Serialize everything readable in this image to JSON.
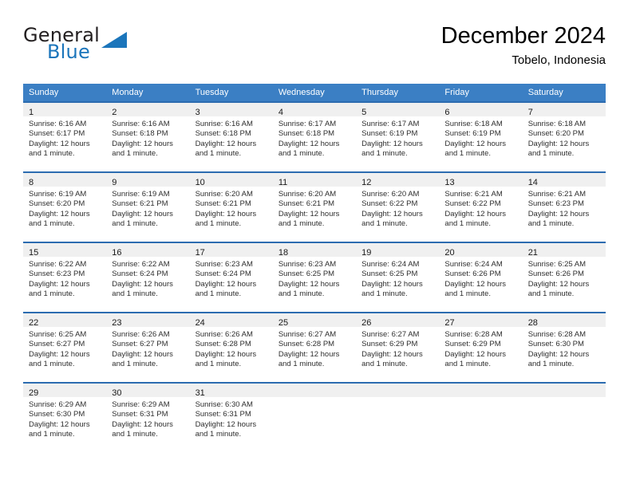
{
  "logo": {
    "word1": "General",
    "word2": "Blue",
    "triangle_color": "#1b75bb",
    "triangle_icon": "triangle-icon"
  },
  "header": {
    "title": "December 2024",
    "location": "Tobelo, Indonesia"
  },
  "colors": {
    "header_row_bg": "#3b7fc4",
    "cell_top_border": "#2c6cb0",
    "daynum_band_bg": "#f0f0f0",
    "brand_blue": "#1b75bb"
  },
  "weekday_headers": [
    "Sunday",
    "Monday",
    "Tuesday",
    "Wednesday",
    "Thursday",
    "Friday",
    "Saturday"
  ],
  "weeks": [
    [
      {
        "day": "1",
        "sunrise": "Sunrise: 6:16 AM",
        "sunset": "Sunset: 6:17 PM",
        "daylight1": "Daylight: 12 hours",
        "daylight2": "and 1 minute."
      },
      {
        "day": "2",
        "sunrise": "Sunrise: 6:16 AM",
        "sunset": "Sunset: 6:18 PM",
        "daylight1": "Daylight: 12 hours",
        "daylight2": "and 1 minute."
      },
      {
        "day": "3",
        "sunrise": "Sunrise: 6:16 AM",
        "sunset": "Sunset: 6:18 PM",
        "daylight1": "Daylight: 12 hours",
        "daylight2": "and 1 minute."
      },
      {
        "day": "4",
        "sunrise": "Sunrise: 6:17 AM",
        "sunset": "Sunset: 6:18 PM",
        "daylight1": "Daylight: 12 hours",
        "daylight2": "and 1 minute."
      },
      {
        "day": "5",
        "sunrise": "Sunrise: 6:17 AM",
        "sunset": "Sunset: 6:19 PM",
        "daylight1": "Daylight: 12 hours",
        "daylight2": "and 1 minute."
      },
      {
        "day": "6",
        "sunrise": "Sunrise: 6:18 AM",
        "sunset": "Sunset: 6:19 PM",
        "daylight1": "Daylight: 12 hours",
        "daylight2": "and 1 minute."
      },
      {
        "day": "7",
        "sunrise": "Sunrise: 6:18 AM",
        "sunset": "Sunset: 6:20 PM",
        "daylight1": "Daylight: 12 hours",
        "daylight2": "and 1 minute."
      }
    ],
    [
      {
        "day": "8",
        "sunrise": "Sunrise: 6:19 AM",
        "sunset": "Sunset: 6:20 PM",
        "daylight1": "Daylight: 12 hours",
        "daylight2": "and 1 minute."
      },
      {
        "day": "9",
        "sunrise": "Sunrise: 6:19 AM",
        "sunset": "Sunset: 6:21 PM",
        "daylight1": "Daylight: 12 hours",
        "daylight2": "and 1 minute."
      },
      {
        "day": "10",
        "sunrise": "Sunrise: 6:20 AM",
        "sunset": "Sunset: 6:21 PM",
        "daylight1": "Daylight: 12 hours",
        "daylight2": "and 1 minute."
      },
      {
        "day": "11",
        "sunrise": "Sunrise: 6:20 AM",
        "sunset": "Sunset: 6:21 PM",
        "daylight1": "Daylight: 12 hours",
        "daylight2": "and 1 minute."
      },
      {
        "day": "12",
        "sunrise": "Sunrise: 6:20 AM",
        "sunset": "Sunset: 6:22 PM",
        "daylight1": "Daylight: 12 hours",
        "daylight2": "and 1 minute."
      },
      {
        "day": "13",
        "sunrise": "Sunrise: 6:21 AM",
        "sunset": "Sunset: 6:22 PM",
        "daylight1": "Daylight: 12 hours",
        "daylight2": "and 1 minute."
      },
      {
        "day": "14",
        "sunrise": "Sunrise: 6:21 AM",
        "sunset": "Sunset: 6:23 PM",
        "daylight1": "Daylight: 12 hours",
        "daylight2": "and 1 minute."
      }
    ],
    [
      {
        "day": "15",
        "sunrise": "Sunrise: 6:22 AM",
        "sunset": "Sunset: 6:23 PM",
        "daylight1": "Daylight: 12 hours",
        "daylight2": "and 1 minute."
      },
      {
        "day": "16",
        "sunrise": "Sunrise: 6:22 AM",
        "sunset": "Sunset: 6:24 PM",
        "daylight1": "Daylight: 12 hours",
        "daylight2": "and 1 minute."
      },
      {
        "day": "17",
        "sunrise": "Sunrise: 6:23 AM",
        "sunset": "Sunset: 6:24 PM",
        "daylight1": "Daylight: 12 hours",
        "daylight2": "and 1 minute."
      },
      {
        "day": "18",
        "sunrise": "Sunrise: 6:23 AM",
        "sunset": "Sunset: 6:25 PM",
        "daylight1": "Daylight: 12 hours",
        "daylight2": "and 1 minute."
      },
      {
        "day": "19",
        "sunrise": "Sunrise: 6:24 AM",
        "sunset": "Sunset: 6:25 PM",
        "daylight1": "Daylight: 12 hours",
        "daylight2": "and 1 minute."
      },
      {
        "day": "20",
        "sunrise": "Sunrise: 6:24 AM",
        "sunset": "Sunset: 6:26 PM",
        "daylight1": "Daylight: 12 hours",
        "daylight2": "and 1 minute."
      },
      {
        "day": "21",
        "sunrise": "Sunrise: 6:25 AM",
        "sunset": "Sunset: 6:26 PM",
        "daylight1": "Daylight: 12 hours",
        "daylight2": "and 1 minute."
      }
    ],
    [
      {
        "day": "22",
        "sunrise": "Sunrise: 6:25 AM",
        "sunset": "Sunset: 6:27 PM",
        "daylight1": "Daylight: 12 hours",
        "daylight2": "and 1 minute."
      },
      {
        "day": "23",
        "sunrise": "Sunrise: 6:26 AM",
        "sunset": "Sunset: 6:27 PM",
        "daylight1": "Daylight: 12 hours",
        "daylight2": "and 1 minute."
      },
      {
        "day": "24",
        "sunrise": "Sunrise: 6:26 AM",
        "sunset": "Sunset: 6:28 PM",
        "daylight1": "Daylight: 12 hours",
        "daylight2": "and 1 minute."
      },
      {
        "day": "25",
        "sunrise": "Sunrise: 6:27 AM",
        "sunset": "Sunset: 6:28 PM",
        "daylight1": "Daylight: 12 hours",
        "daylight2": "and 1 minute."
      },
      {
        "day": "26",
        "sunrise": "Sunrise: 6:27 AM",
        "sunset": "Sunset: 6:29 PM",
        "daylight1": "Daylight: 12 hours",
        "daylight2": "and 1 minute."
      },
      {
        "day": "27",
        "sunrise": "Sunrise: 6:28 AM",
        "sunset": "Sunset: 6:29 PM",
        "daylight1": "Daylight: 12 hours",
        "daylight2": "and 1 minute."
      },
      {
        "day": "28",
        "sunrise": "Sunrise: 6:28 AM",
        "sunset": "Sunset: 6:30 PM",
        "daylight1": "Daylight: 12 hours",
        "daylight2": "and 1 minute."
      }
    ],
    [
      {
        "day": "29",
        "sunrise": "Sunrise: 6:29 AM",
        "sunset": "Sunset: 6:30 PM",
        "daylight1": "Daylight: 12 hours",
        "daylight2": "and 1 minute."
      },
      {
        "day": "30",
        "sunrise": "Sunrise: 6:29 AM",
        "sunset": "Sunset: 6:31 PM",
        "daylight1": "Daylight: 12 hours",
        "daylight2": "and 1 minute."
      },
      {
        "day": "31",
        "sunrise": "Sunrise: 6:30 AM",
        "sunset": "Sunset: 6:31 PM",
        "daylight1": "Daylight: 12 hours",
        "daylight2": "and 1 minute."
      },
      {
        "day": "",
        "sunrise": "",
        "sunset": "",
        "daylight1": "",
        "daylight2": ""
      },
      {
        "day": "",
        "sunrise": "",
        "sunset": "",
        "daylight1": "",
        "daylight2": ""
      },
      {
        "day": "",
        "sunrise": "",
        "sunset": "",
        "daylight1": "",
        "daylight2": ""
      },
      {
        "day": "",
        "sunrise": "",
        "sunset": "",
        "daylight1": "",
        "daylight2": ""
      }
    ]
  ]
}
